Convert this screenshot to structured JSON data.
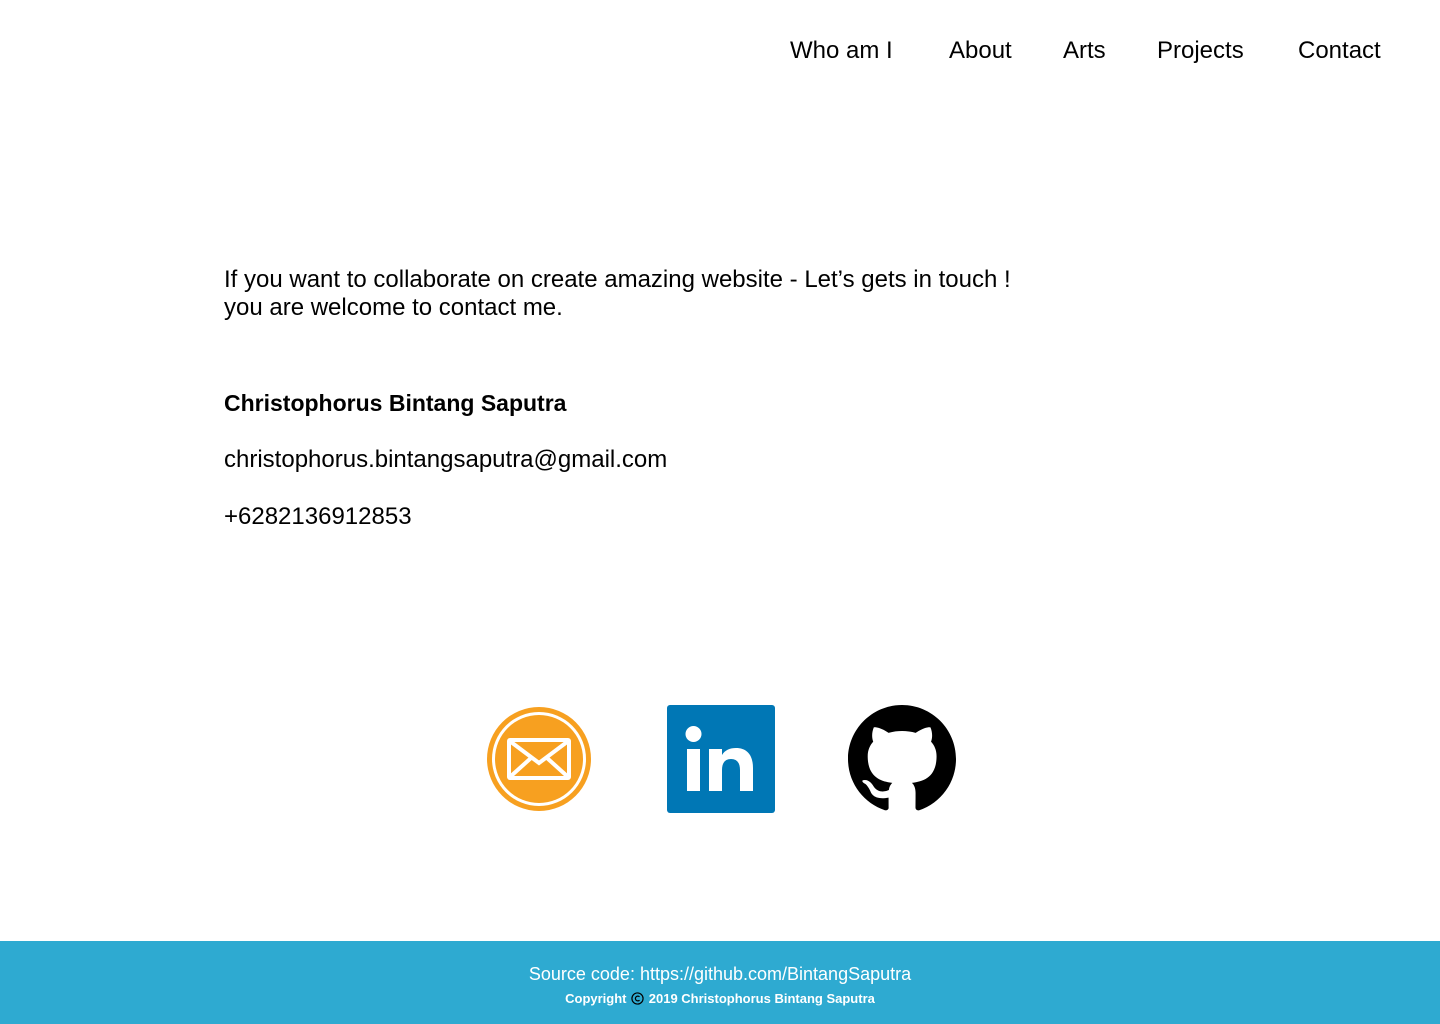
{
  "nav": {
    "items": [
      {
        "label": "Who am I"
      },
      {
        "label": "About"
      },
      {
        "label": "Arts"
      },
      {
        "label": "Projects"
      },
      {
        "label": "Contact"
      }
    ]
  },
  "main": {
    "intro_line1": "If you want to collaborate on create amazing website - Let’s gets in touch !",
    "intro_line2": "you are welcome to contact me.",
    "name": "Christophorus Bintang Saputra",
    "email": "christophorus.bintangsaputra@gmail.com",
    "phone": "+6282136912853"
  },
  "social": {
    "icons": [
      "mail-icon",
      "linkedin-icon",
      "github-icon"
    ]
  },
  "footer": {
    "source_prefix": "Source code: ",
    "source_url": "https://github.com/BintangSaputra",
    "copyright_label": "Copyright",
    "copyright_text": "2019 Christophorus Bintang Saputra"
  },
  "colors": {
    "footer_bg": "#2eaad1",
    "mail_orange": "#f7a020",
    "linkedin_blue": "#0077b5",
    "github_black": "#000000"
  }
}
